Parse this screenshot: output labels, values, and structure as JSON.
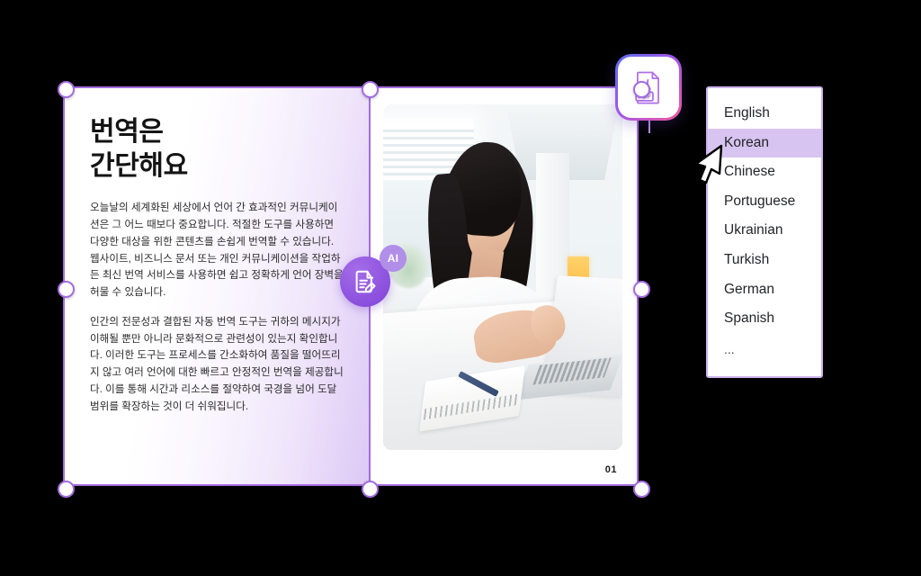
{
  "document": {
    "title": "번역은\n간단해요",
    "paragraphs": [
      "오늘날의 세계화된 세상에서 언어 간 효과적인 커뮤니케이션은 그 어느 때보다 중요합니다. 적절한 도구를 사용하면 다양한 대상을 위한 콘텐츠를 손쉽게 번역할 수 있습니다. 웹사이트, 비즈니스 문서 또는 개인 커뮤니케이션을 작업하든 최신 번역 서비스를 사용하면 쉽고 정확하게 언어 장벽을 허물 수 있습니다.",
      "인간의 전문성과 결합된 자동 번역 도구는 귀하의 메시지가 이해될 뿐만 아니라 문화적으로 관련성이 있는지 확인합니다. 이러한 도구는 프로세스를 간소화하여 품질을 떨어뜨리지 않고 여러 언어에 대한 빠르고 안정적인 번역을 제공합니다. 이를 통해 시간과 리소스를 절약하여 국경을 넘어 도달 범위를 확장하는 것이 더 쉬워집니다."
    ],
    "page_number": "01",
    "photo_alt": "woman-at-laptop-photo"
  },
  "badges": {
    "pdf_label": "PDF",
    "pdf_icon": "pdf-file-icon",
    "ai_label": "AI",
    "ai_icon": "document-edit-icon"
  },
  "language_dropdown": {
    "items": [
      {
        "label": "English",
        "selected": false
      },
      {
        "label": "Korean",
        "selected": true
      },
      {
        "label": "Chinese",
        "selected": false
      },
      {
        "label": "Portuguese",
        "selected": false
      },
      {
        "label": "Ukrainian",
        "selected": false
      },
      {
        "label": "Turkish",
        "selected": false
      },
      {
        "label": "German",
        "selected": false
      },
      {
        "label": "Spanish",
        "selected": false
      }
    ],
    "more_label": "..."
  },
  "cursor": {
    "icon": "mouse-pointer-icon"
  },
  "colors": {
    "selection_purple": "#a46ce0",
    "highlight_lavender": "#d8c4f0",
    "dropdown_border": "#cdb3ec",
    "ai_purple": "#8b4fdd",
    "ai_bubble": "#b18ee8",
    "canvas_background": "#000000",
    "page_background": "#ffffff"
  }
}
